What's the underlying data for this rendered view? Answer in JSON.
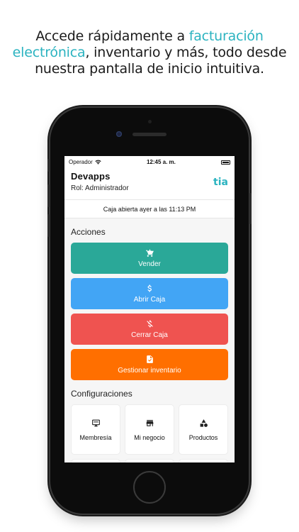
{
  "headline": {
    "part1": "Accede rápidamente a ",
    "accent": "facturación electrónica",
    "part2": ", inventario y más, todo desde nuestra pantalla de inicio intuitiva."
  },
  "status_bar": {
    "carrier": "Operador",
    "time": "12:45 a. m."
  },
  "header": {
    "company": "Devapps",
    "role": "Rol: Administrador",
    "logo_text": "tia"
  },
  "caja_status": "Caja abierta ayer a las 11:13 PM",
  "acciones": {
    "title": "Acciones",
    "items": [
      {
        "label": "Vender",
        "icon": "cart-icon",
        "color": "#2aa898"
      },
      {
        "label": "Abrir Caja",
        "icon": "dollar-icon",
        "color": "#42a5f5"
      },
      {
        "label": "Cerrar Caja",
        "icon": "dollar-off-icon",
        "color": "#ef5350"
      },
      {
        "label": "Gestionar inventario",
        "icon": "clipboard-icon",
        "color": "#ff6f00"
      }
    ]
  },
  "configuraciones": {
    "title": "Configuraciones",
    "items": [
      {
        "label": "Membresía",
        "icon": "monitor-icon"
      },
      {
        "label": "Mi negocio",
        "icon": "store-icon"
      },
      {
        "label": "Productos",
        "icon": "shapes-icon"
      }
    ]
  },
  "colors": {
    "accent": "#2bb3c0"
  }
}
